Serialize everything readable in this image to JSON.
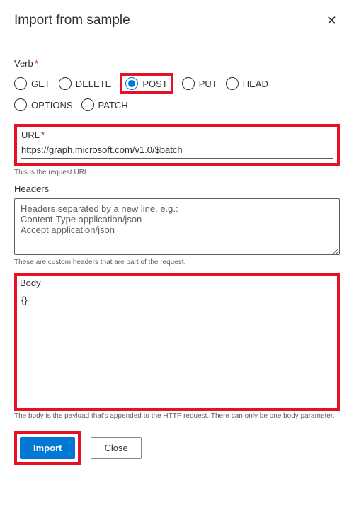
{
  "dialog": {
    "title": "Import from sample"
  },
  "verb": {
    "label": "Verb",
    "required": "*",
    "options": {
      "get": "GET",
      "delete": "DELETE",
      "post": "POST",
      "put": "PUT",
      "head": "HEAD",
      "options": "OPTIONS",
      "patch": "PATCH"
    },
    "selected": "POST"
  },
  "url": {
    "label": "URL",
    "required": "*",
    "value": "https://graph.microsoft.com/v1.0/$batch",
    "helper": "This is the request URL."
  },
  "headers": {
    "label": "Headers",
    "placeholder": "Headers separated by a new line, e.g.:\nContent-Type application/json\nAccept application/json",
    "value": "",
    "helper": "These are custom headers that are part of the request."
  },
  "body": {
    "label": "Body",
    "value": "{}",
    "helper": "The body is the payload that's appended to the HTTP request. There can only be one body parameter."
  },
  "buttons": {
    "import": "Import",
    "close": "Close"
  }
}
